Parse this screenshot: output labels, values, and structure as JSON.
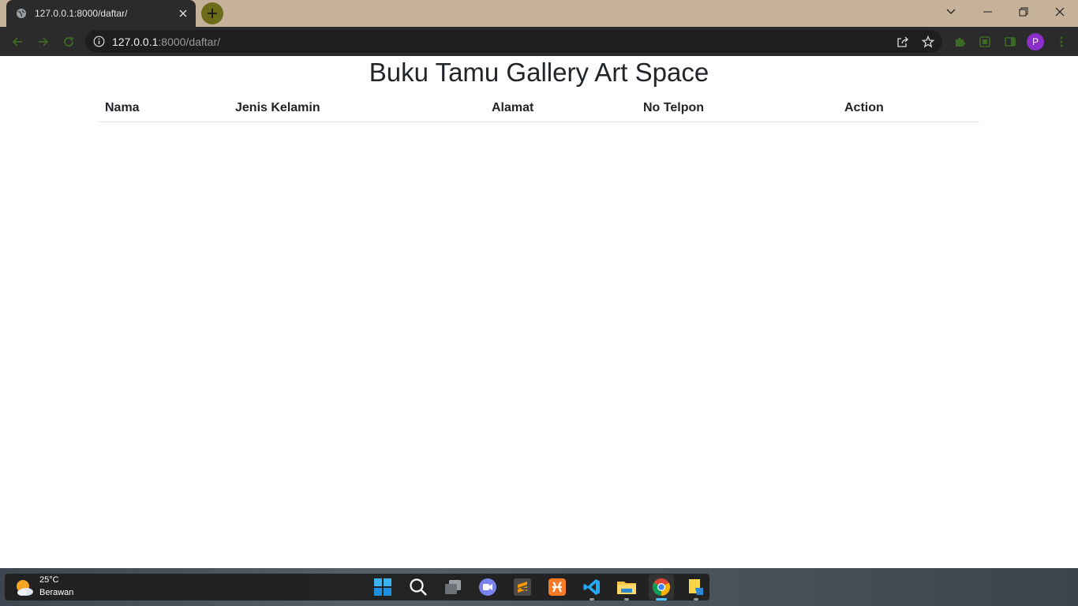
{
  "browser": {
    "tab_title": "127.0.0.1:8000/daftar/",
    "url_host": "127.0.0.1",
    "url_rest": ":8000/daftar/",
    "profile_initial": "P"
  },
  "page": {
    "title": "Buku Tamu Gallery Art Space",
    "table": {
      "headers": [
        "Nama",
        "Jenis Kelamin",
        "Alamat",
        "No Telpon",
        "Action"
      ],
      "rows": []
    }
  },
  "taskbar": {
    "weather_temp": "25°C",
    "weather_desc": "Berawan",
    "apps": [
      "windows-start",
      "search",
      "task-view",
      "teams",
      "sublime-text",
      "xampp",
      "vscode",
      "file-explorer",
      "chrome",
      "sticky-notes"
    ]
  }
}
